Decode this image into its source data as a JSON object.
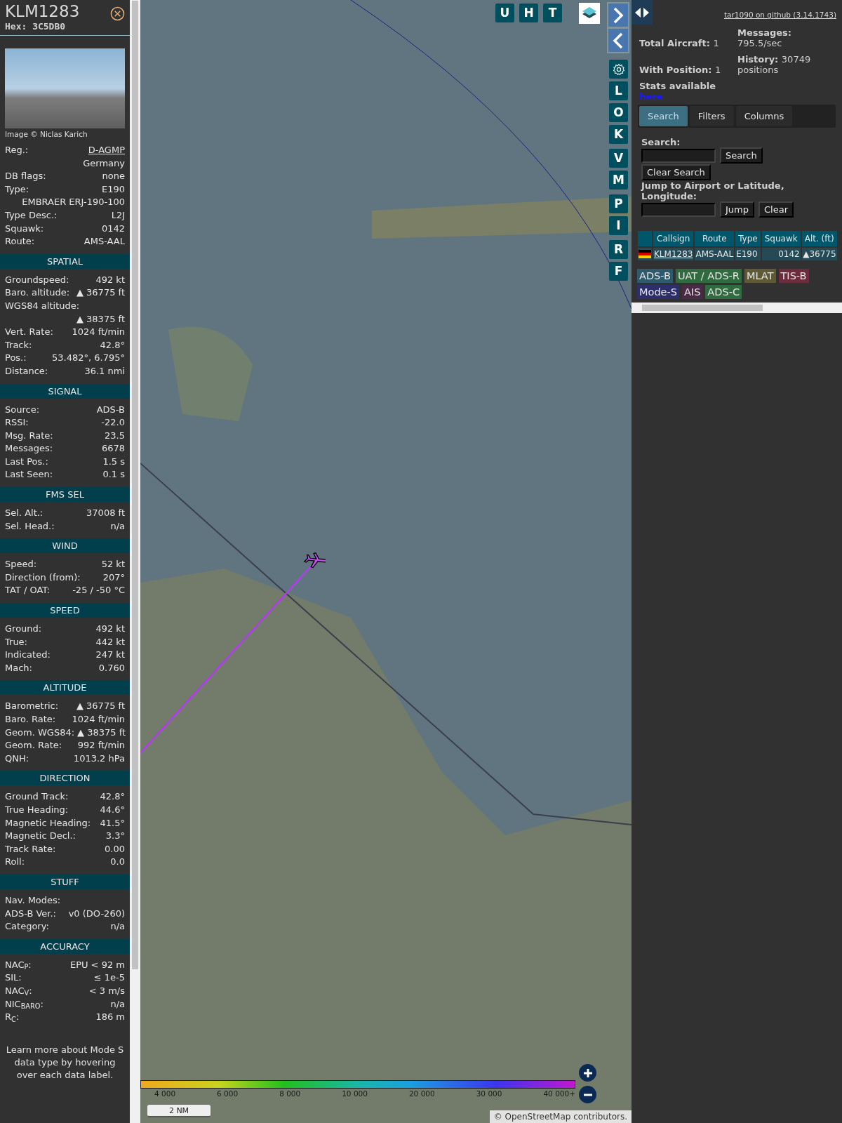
{
  "aircraft": {
    "callsign": "KLM1283",
    "hex": "Hex: 3C5DB0",
    "photo_credit": "Image © Niclas Karich"
  },
  "info_rows": [
    {
      "label": "Reg.:",
      "value": "D-AGMP",
      "kind": "link"
    },
    {
      "value": "Germany"
    },
    {
      "label": "DB flags:",
      "value": "none"
    },
    {
      "label": "Type:",
      "value": "E190"
    },
    {
      "value": "EMBRAER ERJ-190-100"
    },
    {
      "label": "Type Desc.:",
      "value": "L2J"
    },
    {
      "label": "Squawk:",
      "value": "0142"
    },
    {
      "label": "Route:",
      "value": "AMS-AAL"
    }
  ],
  "sections": [
    {
      "title": "SPATIAL",
      "rows": [
        {
          "label": "Groundspeed:",
          "value": "492 kt"
        },
        {
          "label": "Baro. altitude:",
          "value": "▲ 36775 ft"
        },
        {
          "label": "WGS84 altitude:"
        },
        {
          "value": "▲ 38375 ft"
        },
        {
          "label": "Vert. Rate:",
          "value": "1024 ft/min"
        },
        {
          "label": "Track:",
          "value": "42.8°"
        },
        {
          "label": "Pos.:",
          "value": "53.482°, 6.795°"
        },
        {
          "label": "Distance:",
          "value": "36.1 nmi"
        }
      ]
    },
    {
      "title": "SIGNAL",
      "rows": [
        {
          "label": "Source:",
          "value": "ADS-B"
        },
        {
          "label": "RSSI:",
          "value": "-22.0"
        },
        {
          "label": "Msg. Rate:",
          "value": "23.5"
        },
        {
          "label": "Messages:",
          "value": "6678"
        },
        {
          "label": "Last Pos.:",
          "value": "1.5 s"
        },
        {
          "label": "Last Seen:",
          "value": "0.1 s"
        }
      ]
    },
    {
      "title": "FMS SEL",
      "rows": [
        {
          "label": "Sel. Alt.:",
          "value": "37008 ft"
        },
        {
          "label": "Sel. Head.:",
          "value": "n/a"
        }
      ]
    },
    {
      "title": "WIND",
      "rows": [
        {
          "label": "Speed:",
          "value": "52 kt"
        },
        {
          "label": "Direction (from):",
          "value": "207°"
        },
        {
          "label": "TAT / OAT:",
          "value": "-25 / -50 °C"
        }
      ]
    },
    {
      "title": "SPEED",
      "rows": [
        {
          "label": "Ground:",
          "value": "492 kt"
        },
        {
          "label": "True:",
          "value": "442 kt"
        },
        {
          "label": "Indicated:",
          "value": "247 kt"
        },
        {
          "label": "Mach:",
          "value": "0.760"
        }
      ]
    },
    {
      "title": "ALTITUDE",
      "rows": [
        {
          "label": "Barometric:",
          "value": "▲ 36775 ft"
        },
        {
          "label": "Baro. Rate:",
          "value": "1024 ft/min"
        },
        {
          "label": "Geom. WGS84:",
          "value": "▲ 38375 ft"
        },
        {
          "label": "Geom. Rate:",
          "value": "992 ft/min"
        },
        {
          "label": "QNH:",
          "value": "1013.2 hPa"
        }
      ]
    },
    {
      "title": "DIRECTION",
      "rows": [
        {
          "label": "Ground Track:",
          "value": "42.8°"
        },
        {
          "label": "True Heading:",
          "value": "44.6°"
        },
        {
          "label": "Magnetic Heading:",
          "value": "41.5°"
        },
        {
          "label": "Magnetic Decl.:",
          "value": "3.3°"
        },
        {
          "label": "Track Rate:",
          "value": "0.00"
        },
        {
          "label": "Roll:",
          "value": "0.0"
        }
      ]
    },
    {
      "title": "STUFF",
      "rows": [
        {
          "label": "Nav. Modes:"
        },
        {
          "label": "ADS-B Ver.:",
          "value": "v0 (DO-260)"
        },
        {
          "label": "Category:",
          "value": "n/a"
        }
      ]
    },
    {
      "title": "ACCURACY",
      "rows": [
        {
          "label": "NAC$_{P}$:",
          "value": "EPU < 92 m"
        },
        {
          "label": "SIL:",
          "value": "≤ 1e-5"
        },
        {
          "label": "NAC$_{V}$:",
          "value": "< 3 m/s"
        },
        {
          "label": "NIC$_{BARO}$:",
          "value": "n/a"
        },
        {
          "label": "R$_{C}$:",
          "value": "186 m"
        }
      ]
    }
  ],
  "help_text": "Learn more about Mode S data type by hovering over each data label.",
  "map": {
    "top_buttons": [
      "U",
      "H",
      "T"
    ],
    "side_buttons": [
      "L",
      "O",
      "K",
      "V",
      "M",
      "P",
      "I",
      "R",
      "F"
    ],
    "legend_ticks": [
      "4 000",
      "6 000",
      "8 000",
      "10 000",
      "20 000",
      "30 000",
      "40 000+"
    ],
    "scale": "2 NM",
    "copyright": "©",
    "attribution_link": "OpenStreetMap",
    "attribution": "contributors."
  },
  "panel": {
    "link": "tar1090 on github (3.14.1743)",
    "stats": [
      {
        "label": "Total Aircraft:",
        "value": "1"
      },
      {
        "label": "Messages:",
        "value": "795.5/sec"
      },
      {
        "label": "With Position:",
        "value": "1"
      },
      {
        "label": "History:",
        "value": "30749 positions"
      }
    ],
    "stats_note": "Stats available",
    "stats_link": "here",
    "tabs": [
      {
        "label": "Search",
        "selected": true
      },
      {
        "label": "Filters",
        "selected": false
      },
      {
        "label": "Columns",
        "selected": false
      }
    ],
    "search_label": "Search:",
    "search_button": "Search",
    "clear_search_button": "Clear Search",
    "jump_label": "Jump to Airport or Latitude, Longitude:",
    "jump_button": "Jump",
    "clear_button": "Clear",
    "table": {
      "columns": [
        "Callsign",
        "Route",
        "Type",
        "Squawk",
        "Alt. (ft)"
      ],
      "rows": [
        {
          "callsign": "KLM1283",
          "route": "AMS-AAL",
          "type": "E190",
          "squawk": "0142",
          "altitude": "▲36775"
        }
      ]
    },
    "sources": [
      {
        "label": "ADS-B",
        "color": "#2e5a6e"
      },
      {
        "label": "UAT / ADS-R",
        "color": "#2f6b3e"
      },
      {
        "label": "MLAT",
        "color": "#5f5a33"
      },
      {
        "label": "TIS-B",
        "color": "#6b2c3e"
      },
      {
        "label": "Mode-S",
        "color": "#2c2f6b"
      },
      {
        "label": "AIS",
        "color": "#4a2a45"
      },
      {
        "label": "ADS-C",
        "color": "#2f6b3e"
      }
    ]
  }
}
